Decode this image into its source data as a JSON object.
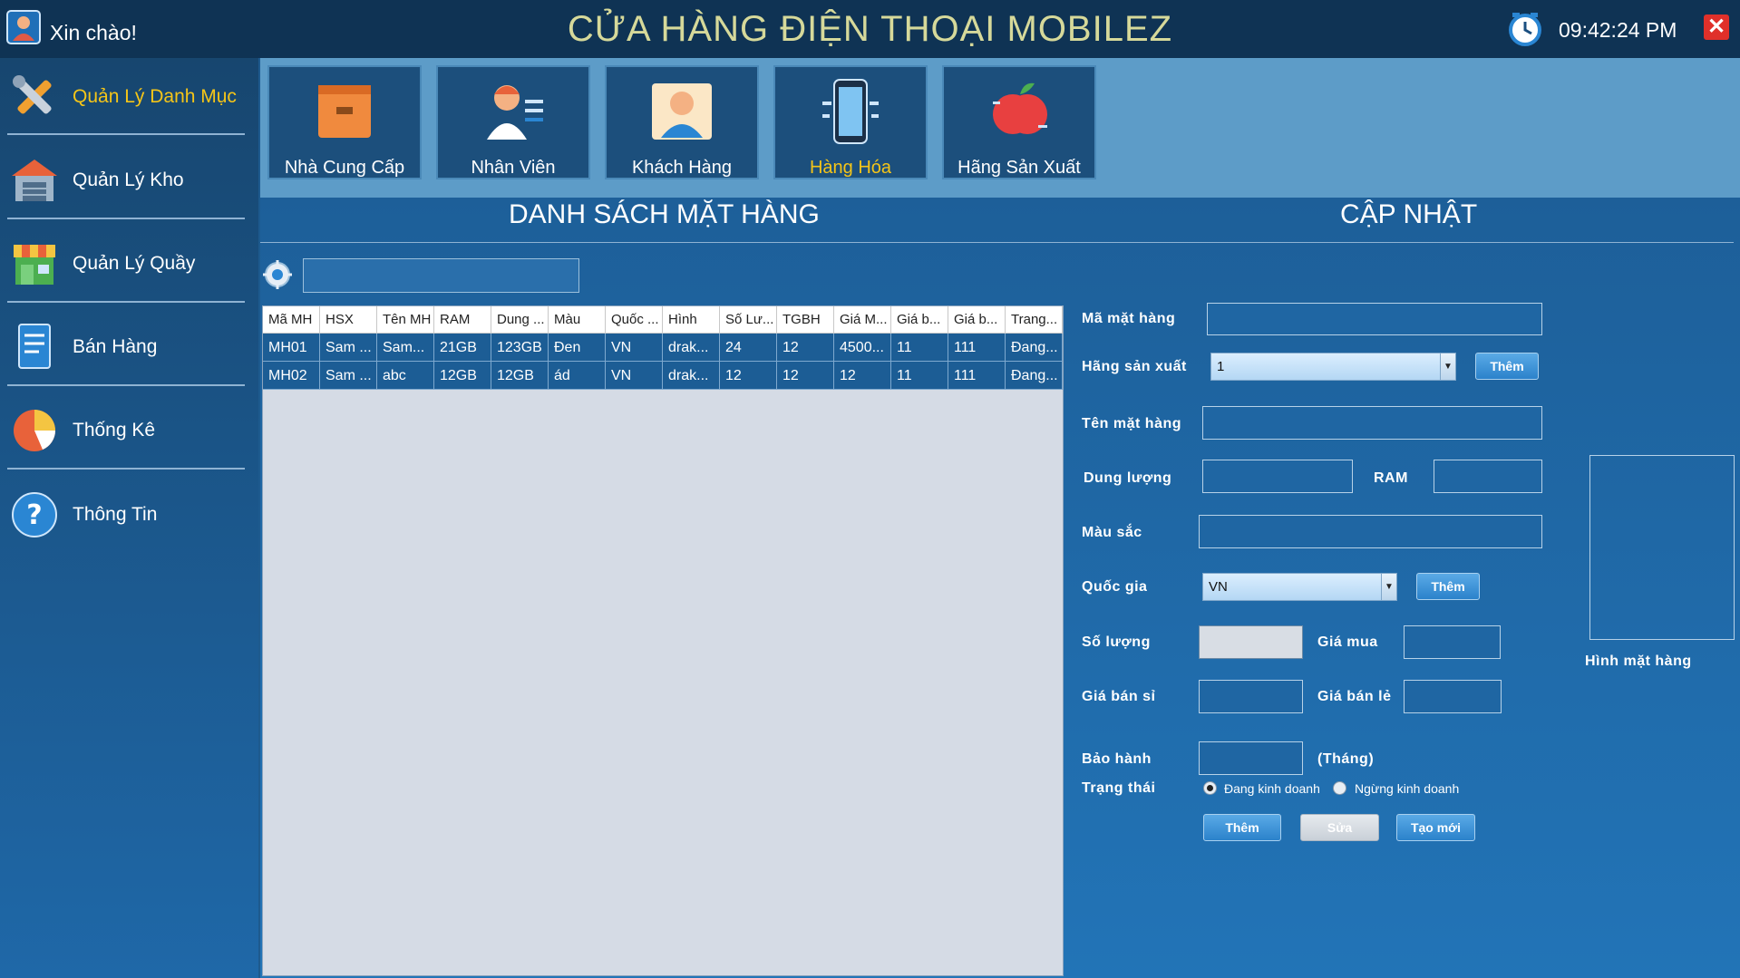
{
  "window": {
    "greeting": "Xin chào!",
    "title": "CỬA HÀNG ĐIỆN THOẠI MOBILEZ",
    "clock": "09:42:24 PM",
    "close_label": "✕"
  },
  "sidebar": {
    "items": [
      {
        "label": "Quản Lý Danh Mục",
        "icon": "tools-icon",
        "active": true
      },
      {
        "label": "Quản Lý Kho",
        "icon": "warehouse-icon"
      },
      {
        "label": "Quản Lý Quầy",
        "icon": "store-icon"
      },
      {
        "label": "Bán Hàng",
        "icon": "sales-icon"
      },
      {
        "label": "Thống Kê",
        "icon": "pie-chart-icon"
      },
      {
        "label": "Thông Tin",
        "icon": "help-icon"
      }
    ]
  },
  "modules": [
    {
      "label": "Nhà Cung Cấp",
      "icon": "box-icon"
    },
    {
      "label": "Nhân Viên",
      "icon": "employee-icon"
    },
    {
      "label": "Khách Hàng",
      "icon": "customer-icon"
    },
    {
      "label": "Hàng Hóa",
      "icon": "phone-icon",
      "active": true
    },
    {
      "label": "Hãng Sản Xuất",
      "icon": "apple-icon"
    }
  ],
  "list": {
    "heading": "DANH SÁCH MẶT HÀNG",
    "search_value": "",
    "columns": [
      "Mã MH",
      "HSX",
      "Tên MH",
      "RAM",
      "Dung ...",
      "Màu",
      "Quốc ...",
      "Hình",
      "Số Lư...",
      "TGBH",
      "Giá M...",
      "Giá b...",
      "Giá b...",
      "Trang..."
    ],
    "rows": [
      [
        "MH01",
        "Sam ...",
        "Sam...",
        "21GB",
        "123GB",
        "Đen",
        "VN",
        "drak...",
        "24",
        "12",
        "4500...",
        "11",
        "111",
        "Đang..."
      ],
      [
        "MH02",
        "Sam ...",
        "abc",
        "12GB",
        "12GB",
        "ád",
        "VN",
        "drak...",
        "12",
        "12",
        "12",
        "11",
        "111",
        "Đang..."
      ]
    ]
  },
  "form": {
    "heading": "CẬP NHẬT",
    "ma_mat_hang_label": "Mã mặt hàng",
    "ma_mat_hang_value": "",
    "hang_sx_label": "Hãng sản xuất",
    "hang_sx_value": "1",
    "ten_mh_label": "Tên mặt hàng",
    "ten_mh_value": "",
    "dung_luong_label": "Dung lượng",
    "dung_luong_value": "",
    "ram_label": "RAM",
    "ram_value": "",
    "mau_sac_label": "Màu sắc",
    "mau_sac_value": "",
    "quoc_gia_label": "Quốc gia",
    "quoc_gia_value": "VN",
    "so_luong_label": "Số lượng",
    "so_luong_value": "",
    "gia_mua_label": "Giá mua",
    "gia_mua_value": "",
    "gia_ban_si_label": "Giá bán sỉ",
    "gia_ban_si_value": "",
    "gia_ban_le_label": "Giá bán lẻ",
    "gia_ban_le_value": "",
    "bao_hanh_label": "Bảo hành",
    "bao_hanh_value": "",
    "bao_hanh_unit": "(Tháng)",
    "trang_thai_label": "Trạng thái",
    "status_active": "Đang kinh doanh",
    "status_inactive": "Ngừng kinh doanh",
    "add_hsx_button": "Thêm",
    "add_country_button": "Thêm",
    "add_button": "Thêm",
    "edit_button": "Sửa",
    "new_button": "Tạo mới",
    "image_label": "Hình mặt hàng"
  }
}
